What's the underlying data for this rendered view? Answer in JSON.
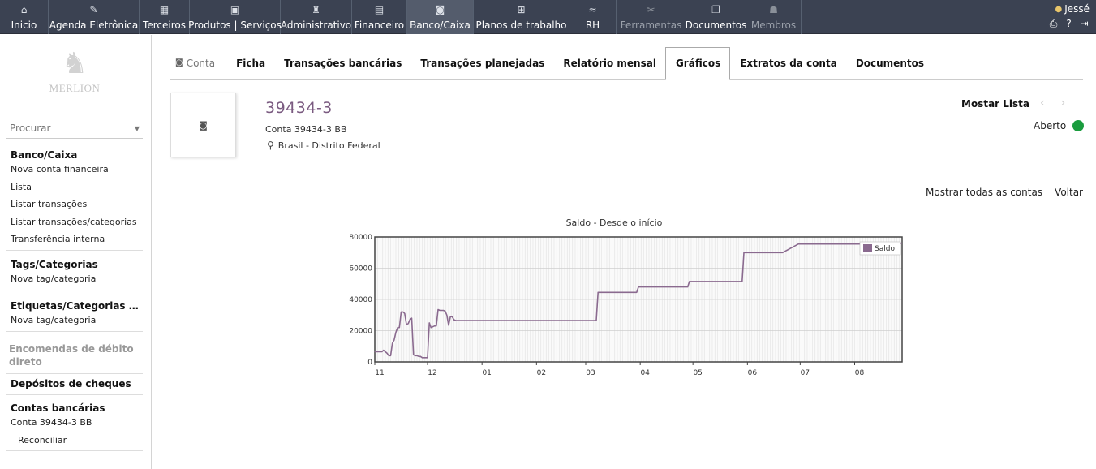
{
  "topnav": {
    "items": [
      {
        "label": "Inicio",
        "icon": "home-icon",
        "glyph": "⌂",
        "state": "normal"
      },
      {
        "label": "Agenda Eletrônica",
        "icon": "agenda-icon",
        "glyph": "✎",
        "state": "normal"
      },
      {
        "label": "Terceiros",
        "icon": "building-icon",
        "glyph": "▦",
        "state": "normal"
      },
      {
        "label": "Produtos | Serviços",
        "icon": "boxes-icon",
        "glyph": "▣",
        "state": "normal"
      },
      {
        "label": "Administrativo",
        "icon": "person-icon",
        "glyph": "♜",
        "state": "normal"
      },
      {
        "label": "Financeiro",
        "icon": "cash-icon",
        "glyph": "▤",
        "state": "normal"
      },
      {
        "label": "Banco/Caixa",
        "icon": "safe-icon",
        "glyph": "◙",
        "state": "active"
      },
      {
        "label": "Planos de trabalho",
        "icon": "hierarchy-icon",
        "glyph": "⊞",
        "state": "normal"
      },
      {
        "label": "RH",
        "icon": "hr-icon",
        "glyph": "≈",
        "state": "normal"
      },
      {
        "label": "Ferramentas",
        "icon": "tools-icon",
        "glyph": "✂",
        "state": "disabled"
      },
      {
        "label": "Documentos",
        "icon": "documents-icon",
        "glyph": "❐",
        "state": "normal"
      },
      {
        "label": "Membros",
        "icon": "members-icon",
        "glyph": "☗",
        "state": "disabled"
      }
    ]
  },
  "user": {
    "name": "Jessé",
    "icons": [
      "print-icon",
      "help-icon",
      "logout-icon"
    ]
  },
  "logo": {
    "brand": "MERLION"
  },
  "search": {
    "placeholder": "Procurar"
  },
  "sidebar": {
    "sections": [
      {
        "title": "Banco/Caixa",
        "links": [
          "Nova conta financeira",
          "Lista",
          "Listar transações",
          "Listar transações/categorias",
          "Transferência interna"
        ]
      },
      {
        "title": "Tags/Categorias",
        "links": [
          "Nova tag/categoria"
        ]
      },
      {
        "title": "Etiquetas/Categorias de...",
        "links": [
          "Nova tag/categoria"
        ]
      },
      {
        "title": "Encomendas de débito direto",
        "links": []
      },
      {
        "title": "Depósitos de cheques",
        "links": []
      },
      {
        "title": "Contas bancárias",
        "links": [
          "Conta 39434-3 BB",
          "Reconciliar"
        ]
      }
    ]
  },
  "tabs": [
    {
      "label": "Conta",
      "style": "plain"
    },
    {
      "label": "Ficha",
      "style": "normal"
    },
    {
      "label": "Transações bancárias",
      "style": "normal"
    },
    {
      "label": "Transações planejadas",
      "style": "normal"
    },
    {
      "label": "Relatório mensal",
      "style": "normal"
    },
    {
      "label": "Gráficos",
      "style": "active"
    },
    {
      "label": "Extratos da conta",
      "style": "normal"
    },
    {
      "label": "Documentos",
      "style": "normal"
    }
  ],
  "account": {
    "title": "39434-3",
    "subtitle": "Conta 39434-3 BB",
    "location": "Brasil - Distrito Federal",
    "status": "Aberto",
    "status_color": "#1a9c3e"
  },
  "actions": {
    "show_list": "Mostar Lista",
    "show_all": "Mostrar todas as contas",
    "back": "Voltar"
  },
  "chart_data": {
    "type": "line",
    "title": "Saldo - Desde o início",
    "xlabel": "",
    "ylabel": "",
    "ylim": [
      0,
      80000
    ],
    "y_ticks": [
      0,
      20000,
      40000,
      60000,
      80000
    ],
    "x_tick_labels": [
      "11",
      "12",
      "01",
      "02",
      "03",
      "04",
      "05",
      "06",
      "07",
      "08"
    ],
    "xlim": [
      0,
      300
    ],
    "x_tick_positions": [
      0,
      30,
      61,
      92,
      120,
      151,
      181,
      212,
      242,
      273
    ],
    "legend": "top-right",
    "series": [
      {
        "name": "Saldo",
        "color": "#8a6a8f",
        "x": [
          0,
          4,
          5,
          7,
          8,
          9,
          10,
          11,
          12,
          13,
          14,
          15,
          16,
          17,
          18,
          19,
          20,
          21,
          22,
          23,
          24,
          25,
          26,
          27,
          30,
          31,
          32,
          33,
          34,
          35,
          36,
          37,
          38,
          39,
          40,
          41,
          42,
          43,
          44,
          45,
          46,
          47,
          48,
          49,
          50,
          51,
          52,
          55,
          56,
          58,
          60,
          61,
          62,
          63,
          64,
          65,
          66,
          67,
          70,
          74,
          78,
          88,
          95,
          109,
          120,
          126,
          127,
          133,
          140,
          149,
          150,
          155,
          160,
          168,
          178,
          179,
          182,
          188,
          195,
          203,
          209,
          210,
          212,
          220,
          232,
          241,
          250,
          273,
          282,
          300
        ],
        "values": [
          6500,
          6500,
          7500,
          5500,
          4000,
          4000,
          12000,
          14000,
          19000,
          22000,
          22000,
          32000,
          32000,
          31000,
          24000,
          24500,
          27000,
          28000,
          4500,
          4000,
          4000,
          3500,
          3500,
          2700,
          2700,
          25000,
          22000,
          22500,
          23000,
          23000,
          33500,
          33000,
          33000,
          33000,
          32500,
          30000,
          23500,
          29000,
          29000,
          27000,
          26500,
          26500,
          26500,
          26500,
          26500,
          26500,
          26500,
          26500,
          26500,
          26500,
          26500,
          26500,
          26500,
          26500,
          26500,
          26500,
          26500,
          26500,
          26500,
          26500,
          26500,
          26500,
          26500,
          26500,
          26500,
          26500,
          44500,
          44500,
          44500,
          44500,
          48000,
          48000,
          48000,
          48000,
          48000,
          51500,
          51500,
          51500,
          51500,
          51500,
          51500,
          70000,
          70000,
          70000,
          70000,
          75500,
          75500,
          75500,
          75500,
          76000
        ]
      }
    ]
  }
}
